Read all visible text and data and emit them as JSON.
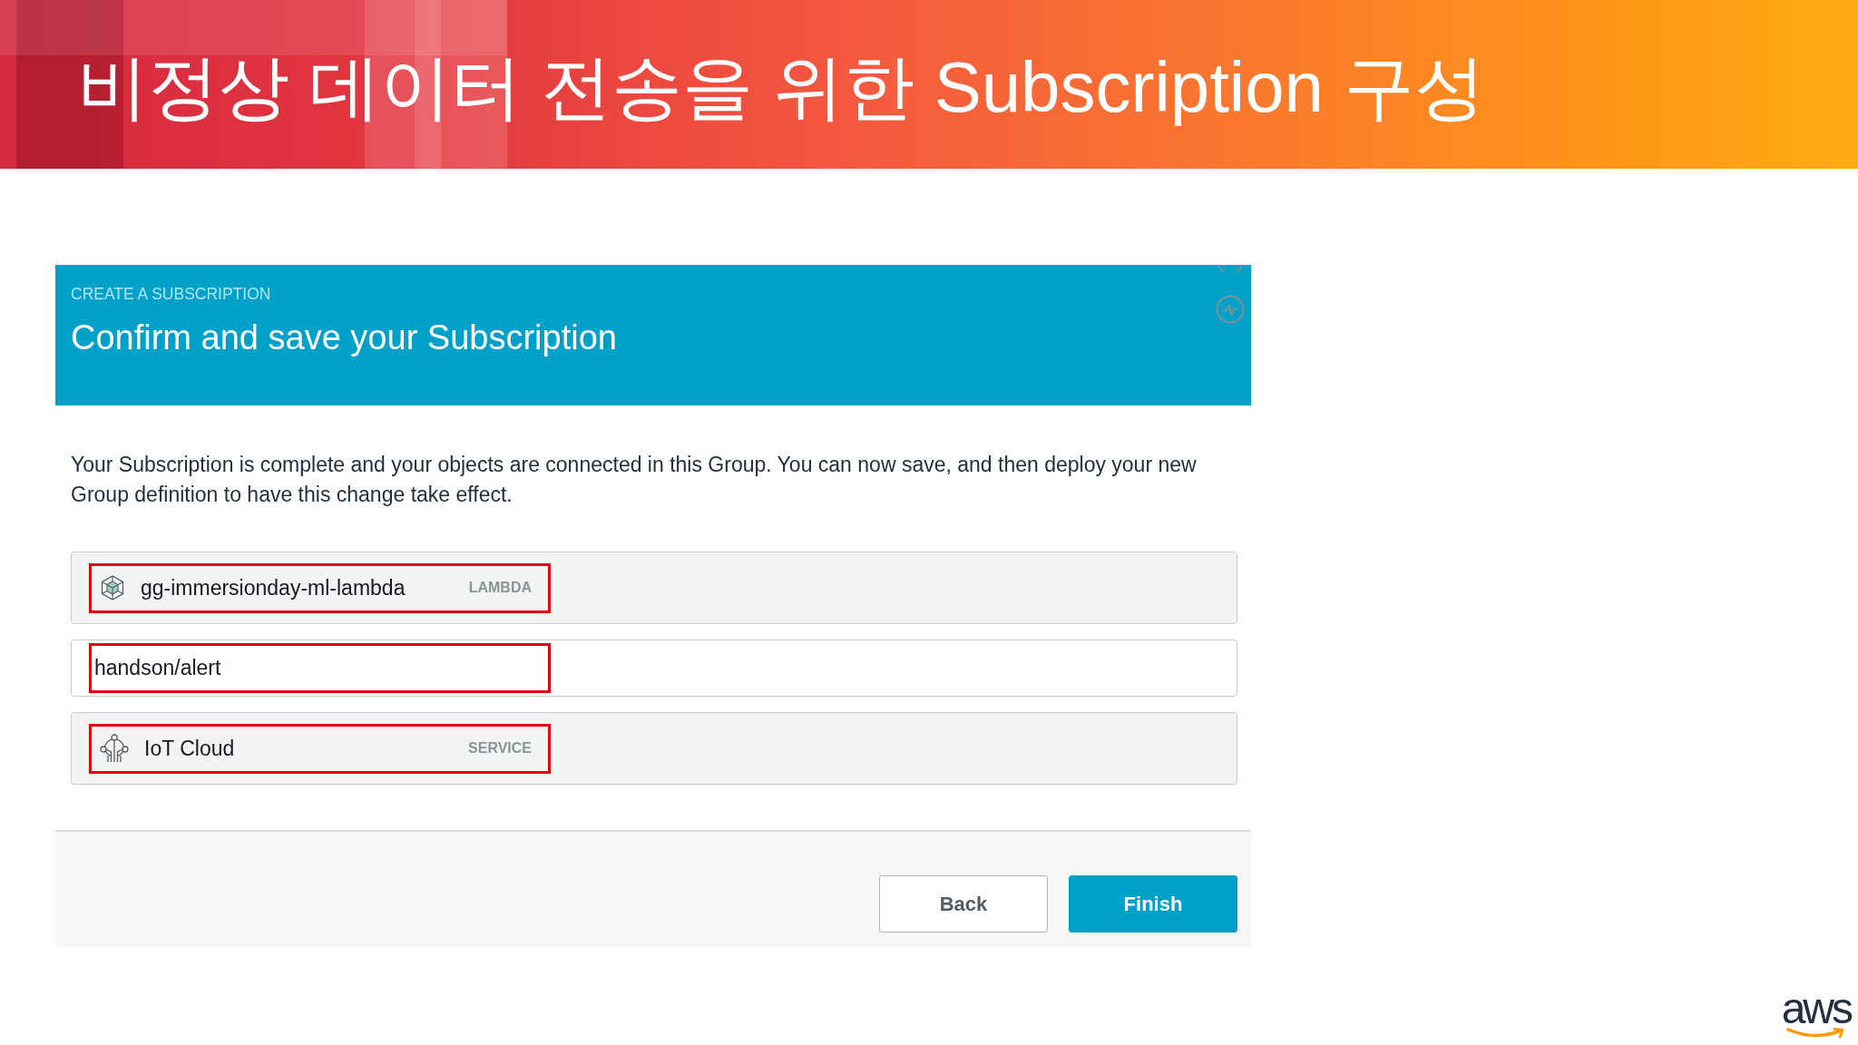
{
  "slide": {
    "title": "비정상 데이터 전송을 위한 Subscription 구성"
  },
  "panel": {
    "eyebrow": "CREATE A SUBSCRIPTION",
    "heading": "Confirm and save your Subscription"
  },
  "description": "Your Subscription is complete and your objects are connected in this Group. You can now save, and then deploy your new Group definition to have this change take effect.",
  "rows": [
    {
      "kind": "lambda",
      "name": "gg-immersionday-ml-lambda",
      "type": "LAMBDA",
      "highlighted": true
    },
    {
      "kind": "topic",
      "name": "handson/alert",
      "highlighted": true
    },
    {
      "kind": "service",
      "name": "IoT Cloud",
      "type": "SERVICE",
      "highlighted": true
    }
  ],
  "buttons": [
    {
      "kind": "secondary",
      "label": "Back"
    },
    {
      "kind": "primary",
      "label": "Finish"
    }
  ],
  "logo": {
    "text": "aws"
  }
}
